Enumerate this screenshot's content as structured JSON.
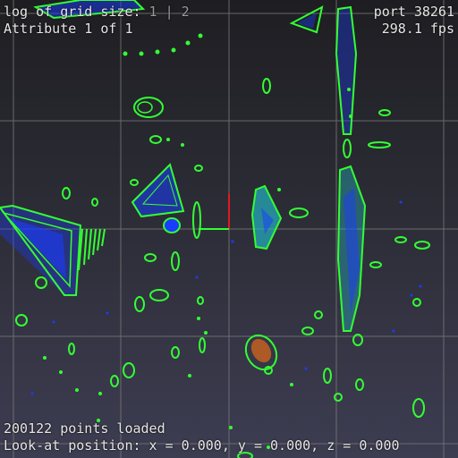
{
  "hud": {
    "grid_label": "log of grid size:",
    "grid_values": " 1 | 2",
    "attribute": "Attribute 1 of 1",
    "port": "port 38261",
    "fps": "298.1 fps",
    "points": "200122 points loaded",
    "lookat": "Look-at position: x = 0.000, y = 0.000, z = 0.000"
  },
  "colors": {
    "grid": "#7a7a7a",
    "wire": "#33ff33",
    "point_blue": "#1a3cff",
    "point_cyan": "#22c8d8",
    "point_orange": "#e06a1a",
    "axis_red": "#e01a1a",
    "axis_green": "#33ff33"
  }
}
